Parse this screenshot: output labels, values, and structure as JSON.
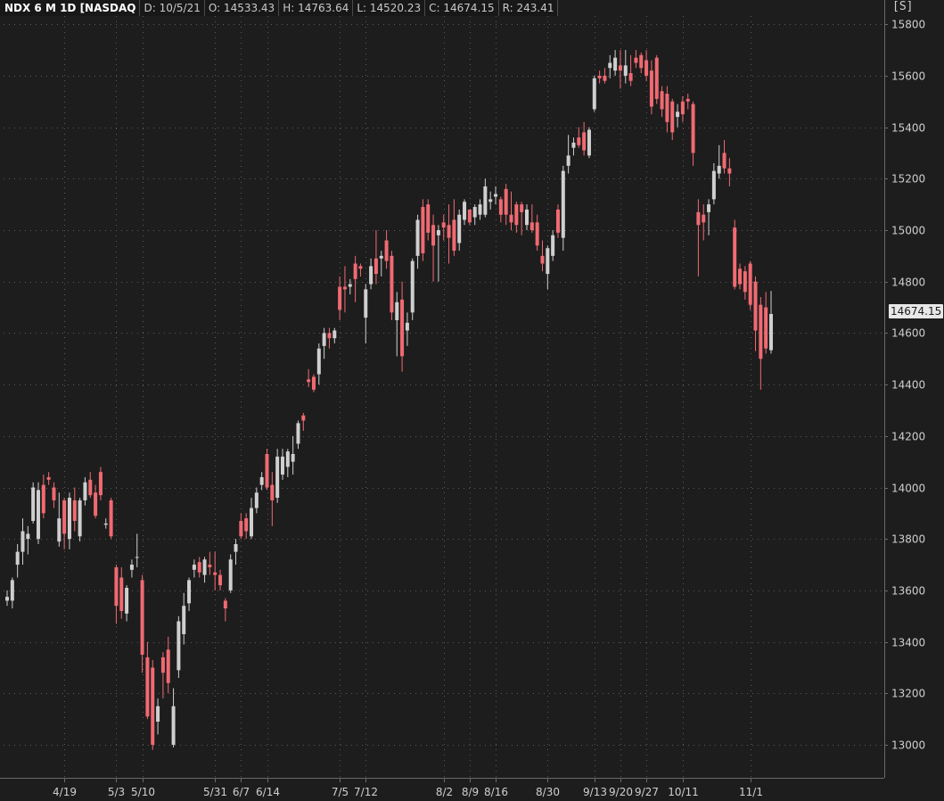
{
  "header": {
    "symbol": "NDX 6 M 1D [NASDAQ",
    "date": "D: 10/5/21",
    "open": "O: 14533.43",
    "high": "H: 14763.64",
    "low": "L: 14520.23",
    "close": "C: 14674.15",
    "range": "R: 243.41"
  },
  "price_tag": "14674.15",
  "colors": {
    "background": "#1d1d1d",
    "up": "#cfcfcf",
    "down": "#f06a72",
    "grid": "#5a5a5a",
    "axis": "#6a6a6a"
  },
  "chart_data": {
    "type": "candlestick",
    "title": "NDX 6 M 1D [NASDAQ",
    "y_range": [
      12900,
      15850
    ],
    "y_ticks": [
      13000,
      13200,
      13400,
      13600,
      13800,
      14000,
      14200,
      14400,
      14600,
      14800,
      15000,
      15200,
      15400,
      15600,
      15800
    ],
    "y_axis_side": "right",
    "x_ticks": [
      {
        "label": "4/19",
        "day": 11
      },
      {
        "label": "5/3",
        "day": 21
      },
      {
        "label": "5/10",
        "day": 26
      },
      {
        "label": "5/31",
        "day": 40
      },
      {
        "label": "6/7",
        "day": 45
      },
      {
        "label": "6/14",
        "day": 50
      },
      {
        "label": "7/5",
        "day": 64
      },
      {
        "label": "7/12",
        "day": 69
      },
      {
        "label": "8/2",
        "day": 84
      },
      {
        "label": "8/9",
        "day": 89
      },
      {
        "label": "8/16",
        "day": 94
      },
      {
        "label": "8/30",
        "day": 104
      },
      {
        "label": "9/13",
        "day": 113
      },
      {
        "label": "9/20",
        "day": 118
      },
      {
        "label": "9/27",
        "day": 123
      },
      {
        "label": "10/11",
        "day": 130
      },
      {
        "label": "11/1",
        "day": 143
      }
    ],
    "grid": true,
    "last_price": 14674.15,
    "candles": [
      [
        0,
        13560,
        13600,
        13540,
        13575
      ],
      [
        1,
        13560,
        13650,
        13530,
        13640
      ],
      [
        2,
        13700,
        13780,
        13650,
        13750
      ],
      [
        3,
        13750,
        13880,
        13700,
        13830
      ],
      [
        4,
        13800,
        13850,
        13740,
        13820
      ],
      [
        5,
        13870,
        14020,
        13860,
        14000
      ],
      [
        6,
        13800,
        14020,
        13780,
        13990
      ],
      [
        7,
        14010,
        14050,
        13880,
        13900
      ],
      [
        8,
        14040,
        14060,
        14010,
        14030
      ],
      [
        9,
        14000,
        14020,
        13920,
        13950
      ],
      [
        10,
        13790,
        13980,
        13770,
        13880
      ],
      [
        11,
        13950,
        13960,
        13760,
        13820
      ],
      [
        12,
        13800,
        13980,
        13760,
        13960
      ],
      [
        13,
        13950,
        14000,
        13830,
        13870
      ],
      [
        14,
        13810,
        13960,
        13790,
        13950
      ],
      [
        15,
        13950,
        14040,
        13930,
        14020
      ],
      [
        16,
        14030,
        14060,
        13960,
        13970
      ],
      [
        17,
        13980,
        14010,
        13880,
        13890
      ],
      [
        18,
        14060,
        14080,
        13950,
        13970
      ],
      [
        19,
        13855,
        13880,
        13840,
        13860
      ],
      [
        20,
        13950,
        13960,
        13800,
        13810
      ],
      [
        21,
        13690,
        13700,
        13470,
        13540
      ],
      [
        22,
        13650,
        13690,
        13490,
        13520
      ],
      [
        23,
        13510,
        13620,
        13480,
        13610
      ],
      [
        24,
        13680,
        13720,
        13650,
        13700
      ],
      [
        25,
        13730,
        13820,
        13690,
        13730
      ],
      [
        26,
        13640,
        13660,
        13280,
        13350
      ],
      [
        27,
        13340,
        13400,
        13100,
        13110
      ],
      [
        28,
        13300,
        13330,
        12980,
        13000
      ],
      [
        29,
        13090,
        13180,
        13040,
        13150
      ],
      [
        30,
        13340,
        13360,
        13180,
        13280
      ],
      [
        31,
        13370,
        13420,
        13200,
        13240
      ],
      [
        32,
        13000,
        13220,
        12990,
        13150
      ],
      [
        33,
        13290,
        13500,
        13260,
        13480
      ],
      [
        34,
        13430,
        13590,
        13390,
        13540
      ],
      [
        35,
        13550,
        13650,
        13520,
        13640
      ],
      [
        36,
        13680,
        13720,
        13650,
        13700
      ],
      [
        37,
        13710,
        13730,
        13650,
        13670
      ],
      [
        38,
        13660,
        13730,
        13630,
        13720
      ],
      [
        39,
        13700,
        13750,
        13660,
        13690
      ],
      [
        40,
        13670,
        13750,
        13600,
        13660
      ],
      [
        41,
        13660,
        13680,
        13600,
        13620
      ],
      [
        42,
        13560,
        13570,
        13480,
        13530
      ],
      [
        43,
        13600,
        13740,
        13590,
        13720
      ],
      [
        44,
        13750,
        13800,
        13700,
        13780
      ],
      [
        45,
        13870,
        13900,
        13800,
        13810
      ],
      [
        46,
        13880,
        13900,
        13800,
        13830
      ],
      [
        47,
        13810,
        13960,
        13800,
        13920
      ],
      [
        48,
        13920,
        14000,
        13900,
        13980
      ],
      [
        49,
        14010,
        14060,
        13990,
        14040
      ],
      [
        50,
        14130,
        14150,
        13990,
        14000
      ],
      [
        51,
        14010,
        14060,
        13850,
        13950
      ],
      [
        52,
        13960,
        14150,
        13940,
        14120
      ],
      [
        53,
        14050,
        14150,
        14030,
        14120
      ],
      [
        54,
        14080,
        14150,
        14040,
        14140
      ],
      [
        55,
        14100,
        14200,
        14050,
        14130
      ],
      [
        56,
        14170,
        14260,
        14150,
        14250
      ],
      [
        57,
        14280,
        14290,
        14220,
        14260
      ],
      [
        58,
        14420,
        14460,
        14390,
        14410
      ],
      [
        59,
        14430,
        14440,
        14370,
        14380
      ],
      [
        60,
        14440,
        14560,
        14400,
        14540
      ],
      [
        61,
        14550,
        14620,
        14500,
        14600
      ],
      [
        62,
        14600,
        14620,
        14540,
        14580
      ],
      [
        63,
        14580,
        14620,
        14560,
        14610
      ],
      [
        64,
        14780,
        14820,
        14650,
        14690
      ],
      [
        65,
        14780,
        14860,
        14680,
        14770
      ],
      [
        66,
        14780,
        14810,
        14750,
        14790
      ],
      [
        67,
        14870,
        14900,
        14720,
        14810
      ],
      [
        68,
        14860,
        14870,
        14820,
        14850
      ],
      [
        69,
        14660,
        14790,
        14560,
        14770
      ],
      [
        70,
        14790,
        14890,
        14770,
        14860
      ],
      [
        71,
        14890,
        15000,
        14790,
        14830
      ],
      [
        72,
        14890,
        14920,
        14820,
        14900
      ],
      [
        73,
        14960,
        15000,
        14850,
        14880
      ],
      [
        74,
        14900,
        14920,
        14650,
        14680
      ],
      [
        75,
        14650,
        14760,
        14510,
        14720
      ],
      [
        76,
        14730,
        14800,
        14450,
        14510
      ],
      [
        77,
        14610,
        14680,
        14550,
        14640
      ],
      [
        78,
        14680,
        14890,
        14650,
        14880
      ],
      [
        79,
        14900,
        15060,
        14850,
        15040
      ],
      [
        80,
        15090,
        15120,
        14880,
        14910
      ],
      [
        81,
        15100,
        15120,
        14960,
        14990
      ],
      [
        82,
        15020,
        15060,
        14800,
        14940
      ],
      [
        83,
        14980,
        15020,
        14800,
        15000
      ],
      [
        84,
        15030,
        15060,
        14960,
        15010
      ],
      [
        85,
        15020,
        15100,
        14870,
        14970
      ],
      [
        86,
        15040,
        15120,
        14900,
        14920
      ],
      [
        87,
        14950,
        15080,
        14920,
        15060
      ],
      [
        88,
        15040,
        15120,
        15020,
        15110
      ],
      [
        89,
        15080,
        15080,
        15020,
        15030
      ],
      [
        90,
        15050,
        15100,
        15020,
        15090
      ],
      [
        91,
        15060,
        15120,
        15040,
        15100
      ],
      [
        92,
        15060,
        15200,
        15050,
        15170
      ],
      [
        93,
        15110,
        15150,
        15080,
        15120
      ],
      [
        94,
        15130,
        15170,
        15100,
        15140
      ],
      [
        95,
        15120,
        15130,
        15030,
        15060
      ],
      [
        96,
        15160,
        15180,
        15020,
        15060
      ],
      [
        97,
        15060,
        15150,
        15000,
        15030
      ],
      [
        98,
        15100,
        15110,
        14990,
        15020
      ],
      [
        99,
        15100,
        15110,
        14980,
        15070
      ],
      [
        100,
        15020,
        15100,
        15000,
        15080
      ],
      [
        101,
        15030,
        15100,
        14990,
        15000
      ],
      [
        102,
        15030,
        15060,
        14920,
        14940
      ],
      [
        103,
        14900,
        14960,
        14840,
        14870
      ],
      [
        104,
        14830,
        14940,
        14770,
        14930
      ],
      [
        105,
        14900,
        15000,
        14880,
        14980
      ],
      [
        106,
        15080,
        15100,
        14970,
        14990
      ],
      [
        107,
        14970,
        15250,
        14920,
        15230
      ],
      [
        108,
        15250,
        15370,
        15220,
        15290
      ],
      [
        109,
        15320,
        15360,
        15290,
        15340
      ],
      [
        110,
        15360,
        15400,
        15320,
        15330
      ],
      [
        111,
        15380,
        15420,
        15290,
        15310
      ],
      [
        112,
        15290,
        15400,
        15280,
        15390
      ],
      [
        113,
        15470,
        15600,
        15460,
        15590
      ],
      [
        114,
        15600,
        15620,
        15570,
        15590
      ],
      [
        115,
        15600,
        15630,
        15570,
        15580
      ],
      [
        116,
        15630,
        15680,
        15590,
        15650
      ],
      [
        117,
        15620,
        15700,
        15600,
        15670
      ],
      [
        118,
        15640,
        15700,
        15550,
        15620
      ],
      [
        119,
        15600,
        15700,
        15570,
        15640
      ],
      [
        120,
        15610,
        15680,
        15560,
        15580
      ],
      [
        121,
        15670,
        15700,
        15630,
        15650
      ],
      [
        122,
        15680,
        15690,
        15610,
        15630
      ],
      [
        123,
        15660,
        15700,
        15580,
        15600
      ],
      [
        124,
        15620,
        15660,
        15450,
        15480
      ],
      [
        125,
        15670,
        15680,
        15490,
        15510
      ],
      [
        126,
        15540,
        15560,
        15440,
        15470
      ],
      [
        127,
        15530,
        15560,
        15380,
        15420
      ],
      [
        128,
        15500,
        15510,
        15350,
        15380
      ],
      [
        129,
        15440,
        15490,
        15400,
        15460
      ],
      [
        130,
        15500,
        15520,
        15420,
        15450
      ],
      [
        131,
        15510,
        15530,
        15470,
        15500
      ],
      [
        132,
        15490,
        15500,
        15250,
        15300
      ],
      [
        133,
        15070,
        15120,
        14820,
        15020
      ],
      [
        134,
        15060,
        15100,
        14960,
        15030
      ],
      [
        135,
        15070,
        15120,
        14980,
        15100
      ],
      [
        136,
        15120,
        15260,
        15100,
        15230
      ],
      [
        137,
        15220,
        15330,
        15200,
        15250
      ],
      [
        138,
        15300,
        15350,
        15220,
        15240
      ],
      [
        139,
        15240,
        15280,
        15170,
        15220
      ],
      [
        140,
        15010,
        15040,
        14770,
        14780
      ],
      [
        141,
        14850,
        14870,
        14770,
        14790
      ],
      [
        142,
        14840,
        14860,
        14730,
        14760
      ],
      [
        143,
        14870,
        14880,
        14690,
        14710
      ],
      [
        144,
        14800,
        14820,
        14530,
        14610
      ],
      [
        145,
        14710,
        14740,
        14380,
        14500
      ],
      [
        146,
        14700,
        14760,
        14520,
        14540
      ],
      [
        147,
        14533.43,
        14763.64,
        14520.23,
        14674.15
      ]
    ]
  }
}
